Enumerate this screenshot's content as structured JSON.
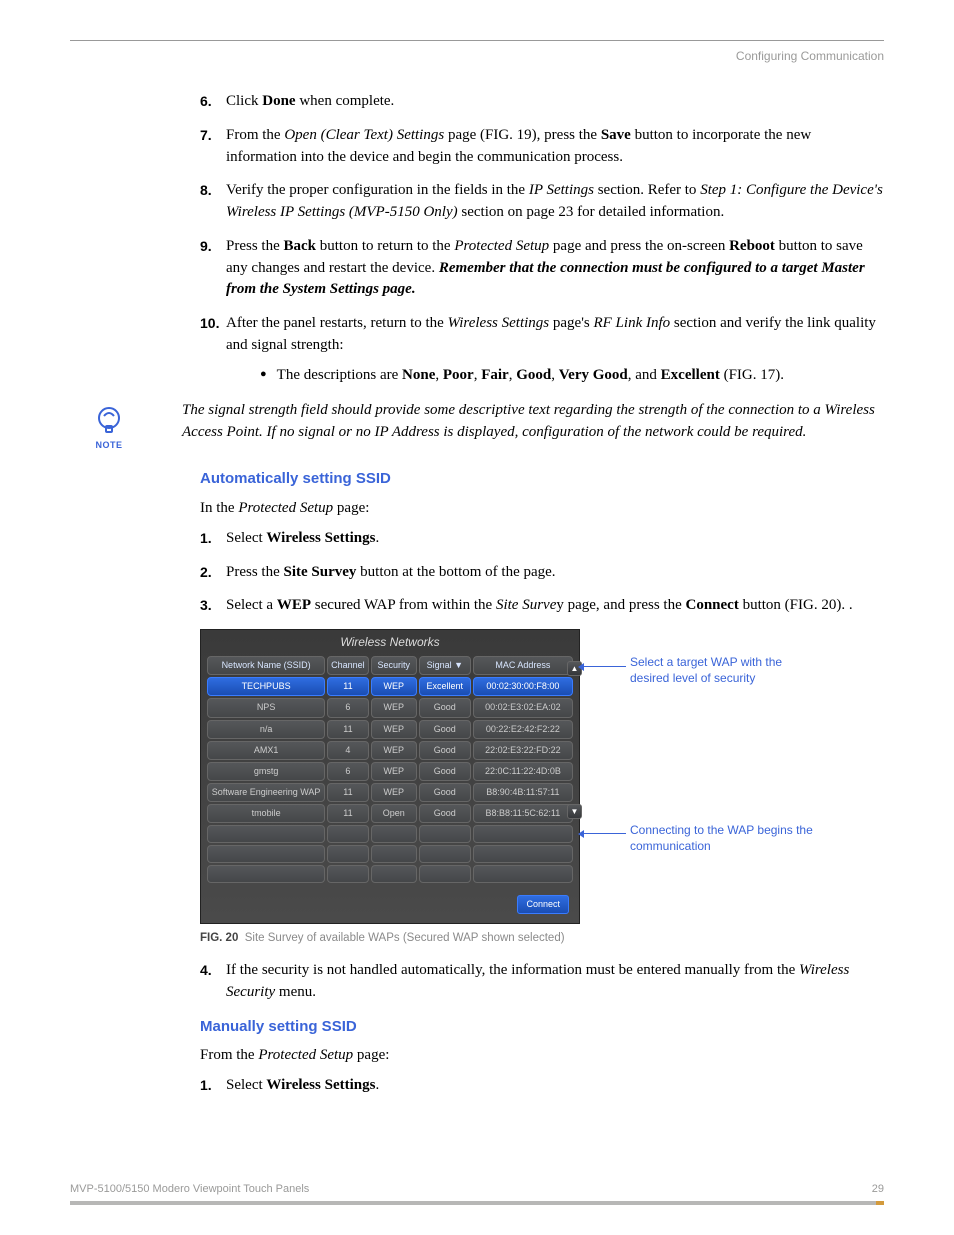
{
  "header": {
    "running_title": "Configuring Communication"
  },
  "steps_first": [
    {
      "num": "6.",
      "runs": [
        {
          "t": "Click "
        },
        {
          "t": "Done",
          "b": true
        },
        {
          "t": " when complete."
        }
      ]
    },
    {
      "num": "7.",
      "runs": [
        {
          "t": "From the "
        },
        {
          "t": "Open (Clear Text) Settings",
          "i": true
        },
        {
          "t": " page (FIG. 19), press the "
        },
        {
          "t": "Save",
          "b": true
        },
        {
          "t": " button to incorporate the new information into the device and begin the communication process."
        }
      ]
    },
    {
      "num": "8.",
      "runs": [
        {
          "t": "Verify the proper configuration in the fields in the "
        },
        {
          "t": "IP Settings",
          "i": true
        },
        {
          "t": " section. Refer to "
        },
        {
          "t": "Step 1: Configure the Device's Wireless IP Settings (MVP-5150 Only)",
          "i": true
        },
        {
          "t": " section on page 23 for detailed information."
        }
      ]
    },
    {
      "num": "9.",
      "runs": [
        {
          "t": "Press the "
        },
        {
          "t": "Back",
          "b": true
        },
        {
          "t": " button to return to the "
        },
        {
          "t": "Protected Setup",
          "i": true
        },
        {
          "t": " page and press the on-screen "
        },
        {
          "t": "Reboot",
          "b": true
        },
        {
          "t": " button to save any changes and restart the device. "
        },
        {
          "t": "Remember that the connection must be configured to a target Master from the System Settings page.",
          "bi": true
        }
      ]
    },
    {
      "num": "10.",
      "runs": [
        {
          "t": "After the panel restarts, return to the "
        },
        {
          "t": "Wireless Settings",
          "i": true
        },
        {
          "t": " page's "
        },
        {
          "t": "RF Link Info",
          "i": true
        },
        {
          "t": " section and verify the link quality and signal strength:"
        }
      ],
      "bullet_runs": [
        {
          "t": "The descriptions are "
        },
        {
          "t": "None",
          "b": true
        },
        {
          "t": ", "
        },
        {
          "t": "Poor",
          "b": true
        },
        {
          "t": ", "
        },
        {
          "t": "Fair",
          "b": true
        },
        {
          "t": ", "
        },
        {
          "t": "Good",
          "b": true
        },
        {
          "t": ", "
        },
        {
          "t": "Very Good",
          "b": true
        },
        {
          "t": ", and "
        },
        {
          "t": "Excellent",
          "b": true
        },
        {
          "t": " (FIG. 17)."
        }
      ]
    }
  ],
  "note": {
    "label": "NOTE",
    "text": "The signal strength field should provide some descriptive text regarding the strength of the connection to a Wireless Access Point. If no signal or no IP Address is displayed, configuration of the network could be required."
  },
  "section_auto": {
    "heading": "Automatically setting SSID",
    "intro_runs": [
      {
        "t": "In the "
      },
      {
        "t": "Protected Setup",
        "i": true
      },
      {
        "t": " page:"
      }
    ],
    "steps": [
      {
        "runs": [
          {
            "t": "Select "
          },
          {
            "t": "Wireless Settings",
            "b": true
          },
          {
            "t": "."
          }
        ]
      },
      {
        "runs": [
          {
            "t": "Press the "
          },
          {
            "t": "Site Survey",
            "b": true
          },
          {
            "t": " button at the bottom of the page."
          }
        ]
      },
      {
        "runs": [
          {
            "t": "Select a "
          },
          {
            "t": "WEP",
            "b": true
          },
          {
            "t": " secured WAP from within the "
          },
          {
            "t": "Site Surve",
            "i": true
          },
          {
            "t": "y page, and press the "
          },
          {
            "t": "Connect",
            "b": true
          },
          {
            "t": " button (FIG. 20). ."
          }
        ]
      }
    ],
    "step4_runs": [
      {
        "t": "If the security is not handled automatically, the information must be entered manually from the "
      },
      {
        "t": "Wireless Security",
        "i": true
      },
      {
        "t": " menu."
      }
    ]
  },
  "figure20": {
    "title": "Wireless Networks",
    "headers": [
      "Network Name (SSID)",
      "Channel",
      "Security",
      "Signal ▼",
      "MAC Address"
    ],
    "rows": [
      {
        "ssid": "TECHPUBS",
        "ch": "11",
        "sec": "WEP",
        "sig": "Excellent",
        "mac": "00:02:30:00:F8:00",
        "selected": true
      },
      {
        "ssid": "NPS",
        "ch": "6",
        "sec": "WEP",
        "sig": "Good",
        "mac": "00:02:E3:02:EA:02"
      },
      {
        "ssid": "n/a",
        "ch": "11",
        "sec": "WEP",
        "sig": "Good",
        "mac": "00:22:E2:42:F2:22"
      },
      {
        "ssid": "AMX1",
        "ch": "4",
        "sec": "WEP",
        "sig": "Good",
        "mac": "22:02:E3:22:FD:22"
      },
      {
        "ssid": "gmstg",
        "ch": "6",
        "sec": "WEP",
        "sig": "Good",
        "mac": "22:0C:11:22:4D:0B"
      },
      {
        "ssid": "Software Engineering WAP",
        "ch": "11",
        "sec": "WEP",
        "sig": "Good",
        "mac": "B8:90:4B:11:57:11"
      },
      {
        "ssid": "tmobile",
        "ch": "11",
        "sec": "Open",
        "sig": "Good",
        "mac": "B8:B8:11:5C:62:11"
      }
    ],
    "connect_label": "Connect",
    "callout1": "Select a target WAP with the desired level of security",
    "callout2": "Connecting to the WAP begins the communication",
    "caption_num": "FIG. 20",
    "caption_text": "Site Survey of available WAPs (Secured WAP shown selected)"
  },
  "section_manual": {
    "heading": "Manually setting SSID",
    "intro_runs": [
      {
        "t": "From the "
      },
      {
        "t": "Protected Setup",
        "i": true
      },
      {
        "t": " page:"
      }
    ],
    "steps": [
      {
        "runs": [
          {
            "t": "Select "
          },
          {
            "t": "Wireless Settings",
            "b": true
          },
          {
            "t": "."
          }
        ]
      }
    ]
  },
  "footer": {
    "left": "MVP-5100/5150 Modero Viewpoint  Touch Panels",
    "right": "29"
  }
}
